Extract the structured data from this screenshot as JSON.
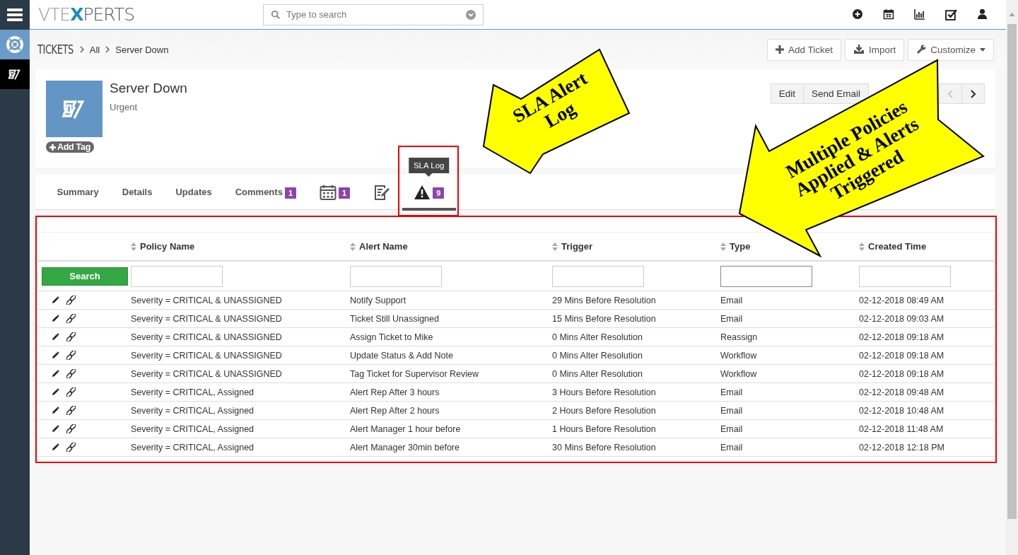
{
  "logo": [
    {
      "text": "VTE",
      "accent": false
    },
    {
      "text": "X",
      "accent": true
    },
    {
      "text": "PERTS",
      "accent": false
    }
  ],
  "search": {
    "placeholder": "Type to search"
  },
  "breadcrumb": [
    "TICKETS",
    "All",
    "Server Down"
  ],
  "header_buttons": [
    {
      "kind": "add",
      "label": "Add Ticket"
    },
    {
      "kind": "import",
      "label": "Import"
    },
    {
      "kind": "customize",
      "label": "Customize"
    }
  ],
  "record": {
    "title": "Server Down",
    "subtitle": "Urgent",
    "add_tag": "Add Tag"
  },
  "record_actions": [
    "Edit",
    "Send Email"
  ],
  "record_nav": [
    {
      "kind": "prev",
      "disabled": true
    },
    {
      "kind": "next",
      "disabled": false
    }
  ],
  "tabs": [
    {
      "kind": "text",
      "label": "Summary",
      "selected": false
    },
    {
      "kind": "text",
      "label": "Details",
      "selected": false
    },
    {
      "kind": "text",
      "label": "Updates",
      "selected": false
    },
    {
      "kind": "text",
      "label": "Comments",
      "badge": "1",
      "selected": false
    },
    {
      "kind": "calendar",
      "badge": "1",
      "selected": false
    },
    {
      "kind": "notes",
      "selected": false
    },
    {
      "kind": "warning",
      "badge": "9",
      "tooltip": "SLA Log",
      "selected": true
    }
  ],
  "table": {
    "search_button": "Search",
    "columns": [
      "Policy Name",
      "Alert Name",
      "Trigger",
      "Type",
      "Created Time"
    ],
    "filters": [
      {
        "focused": false
      },
      {
        "focused": false
      },
      {
        "focused": false
      },
      {
        "focused": true
      },
      {
        "focused": false
      }
    ],
    "rows": [
      [
        "Severity = CRITICAL & UNASSIGNED",
        "Notify Support",
        "29 Mins Before Resolution",
        "Email",
        "02-12-2018 08:49 AM"
      ],
      [
        "Severity = CRITICAL & UNASSIGNED",
        "Ticket Still Unassigned",
        "15 Mins Before Resolution",
        "Email",
        "02-12-2018 09:03 AM"
      ],
      [
        "Severity = CRITICAL & UNASSIGNED",
        "Assign Ticket to Mike",
        "0 Mins Alter Resolution",
        "Reassign",
        "02-12-2018 09:18 AM"
      ],
      [
        "Severity = CRITICAL & UNASSIGNED",
        "Update Status & Add Note",
        "0 Mins Alter Resolution",
        "Workflow",
        "02-12-2018 09:18 AM"
      ],
      [
        "Severity = CRITICAL & UNASSIGNED",
        "Tag Ticket for Supervisor Review",
        "0 Mins Alter Resolution",
        "Workflow",
        "02-12-2018 09:18 AM"
      ],
      [
        "Severity = CRITICAL, Assigned",
        "Alert Rep After 3 hours",
        "3 Hours Before Resolution",
        "Email",
        "02-12-2018 09:48 AM"
      ],
      [
        "Severity = CRITICAL, Assigned",
        "Alert Rep After 2 hours",
        "2 Hours Before Resolution",
        "Email",
        "02-12-2018 10:48 AM"
      ],
      [
        "Severity = CRITICAL, Assigned",
        "Alert Manager 1 hour before",
        "1 Hours Before Resolution",
        "Email",
        "02-12-2018 11:48 AM"
      ],
      [
        "Severity = CRITICAL, Assigned",
        "Alert Manager 30min before",
        "30 Mins Before Resolution",
        "Email",
        "02-12-2018 12:18 PM"
      ]
    ]
  },
  "callouts": [
    {
      "lines": [
        "SLA Alert",
        "Log"
      ]
    },
    {
      "lines": [
        "Multiple Policies",
        "Applied & Alerts",
        "Triggered"
      ]
    }
  ]
}
